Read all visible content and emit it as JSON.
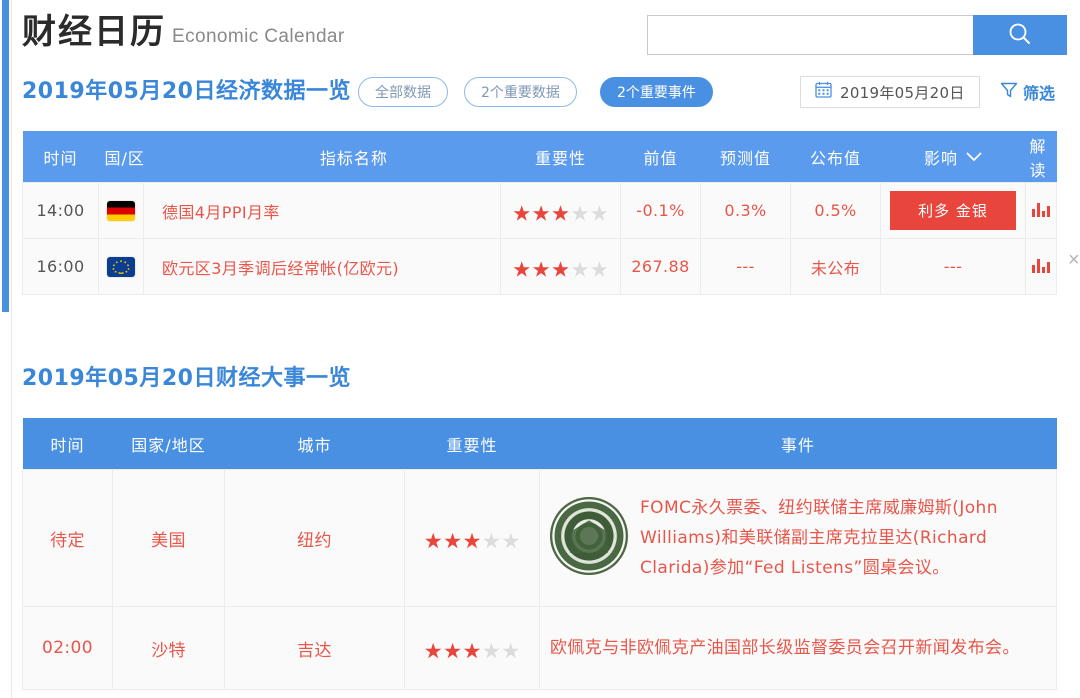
{
  "header": {
    "title_zh": "财经日历",
    "title_en": "Economic Calendar",
    "search": {
      "value": "",
      "placeholder": "",
      "icon": "search-icon"
    }
  },
  "toolbar": {
    "section_title": "2019年05月20日经济数据一览",
    "pills": [
      {
        "label": "全部数据",
        "active": false
      },
      {
        "label": "2个重要数据",
        "active": false
      },
      {
        "label": "2个重要事件",
        "active": true
      }
    ],
    "date_picker": {
      "value": "2019年05月20日",
      "icon": "calendar-icon"
    },
    "filter": {
      "label": "筛选",
      "icon": "funnel-icon"
    }
  },
  "data_table": {
    "columns": [
      "时间",
      "国/区",
      "指标名称",
      "重要性",
      "前值",
      "预测值",
      "公布值",
      "影响",
      "解读"
    ],
    "impact_sort_icon": "chevron-down-icon",
    "rows": [
      {
        "time": "14:00",
        "flag": "flag-de",
        "name": "德国4月PPI月率",
        "stars_on": 3,
        "stars_total": 5,
        "previous": "-0.1%",
        "forecast": "0.3%",
        "actual": "0.5%",
        "impact": "利多 金银",
        "interpret_icon": "bar-chart-icon"
      },
      {
        "time": "16:00",
        "flag": "flag-eu",
        "name": "欧元区3月季调后经常帐(亿欧元)",
        "stars_on": 3,
        "stars_total": 5,
        "previous": "267.88",
        "forecast": "---",
        "actual": "未公布",
        "impact": "---",
        "interpret_icon": "bar-chart-icon"
      }
    ],
    "close_label": "×"
  },
  "events_section": {
    "section_title": "2019年05月20日财经大事一览",
    "columns": [
      "时间",
      "国家/地区",
      "城市",
      "重要性",
      "事件"
    ],
    "rows": [
      {
        "time": "待定",
        "country": "美国",
        "city": "纽约",
        "stars_on": 3,
        "stars_total": 5,
        "logo": "federal-reserve-seal-icon",
        "event": "FOMC永久票委、纽约联储主席威廉姆斯(John Williams)和美联储副主席克拉里达(Richard Clarida)参加“Fed Listens”圆桌会议。"
      },
      {
        "time": "02:00",
        "country": "沙特",
        "city": "吉达",
        "stars_on": 3,
        "stars_total": 5,
        "logo": "",
        "event": "欧佩克与非欧佩克产油国部长级监督委员会召开新闻发布会。"
      }
    ]
  },
  "colors": {
    "brand_blue": "#4a90e2",
    "header_blue": "#5b9bed",
    "title_blue": "#3a86d8",
    "accent_red": "#e8453c",
    "text_red": "#e8564a"
  }
}
